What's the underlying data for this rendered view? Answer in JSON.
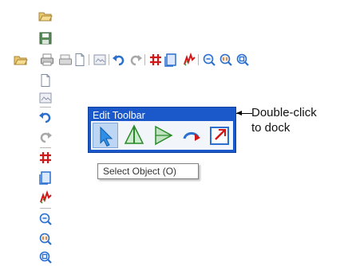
{
  "toolbar_horizontal": {
    "items": [
      "open-folder-icon",
      "print-icon",
      "print-preview-icon",
      "page-icon",
      "image-icon",
      "undo-icon",
      "redo-icon",
      "grid-icon",
      "page-setup-icon",
      "stitch-icon",
      "zoom-icon",
      "zoom-1to1-icon",
      "zoom-fit-icon"
    ]
  },
  "toolbar_vertical": {
    "items": [
      "open-folder-icon",
      "save-icon",
      "print-icon",
      "page-icon",
      "image-icon",
      "undo-icon",
      "redo-icon",
      "grid-icon",
      "page-setup-icon",
      "stitch-icon",
      "zoom-icon",
      "zoom-1to1-icon",
      "zoom-fit-icon"
    ]
  },
  "edit_toolbar": {
    "title": "Edit Toolbar",
    "tools": [
      "select-arrow-icon",
      "reshape-icon",
      "play-icon",
      "rotate-icon",
      "scale-icon"
    ],
    "selected": "select-arrow-icon",
    "title_color": "#1b58c9"
  },
  "tooltip": {
    "text": "Select Object (O)"
  },
  "callout": {
    "line1": "Double-click",
    "line2": "to dock"
  }
}
